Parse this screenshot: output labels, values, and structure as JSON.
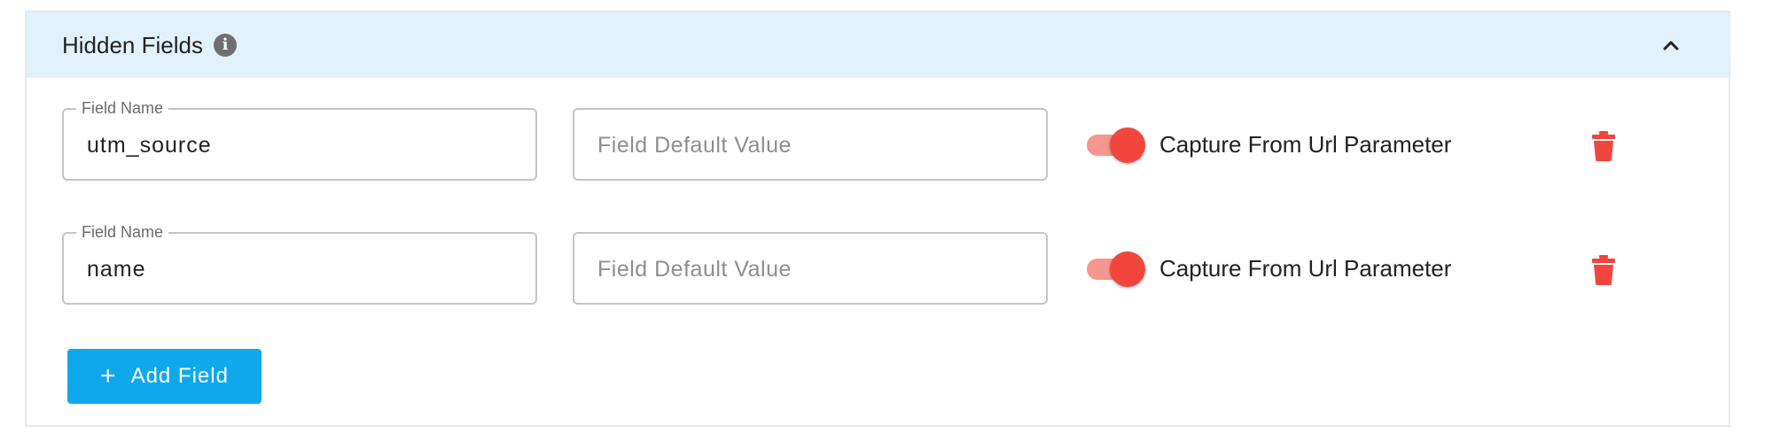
{
  "panel": {
    "title": "Hidden Fields",
    "info_icon": "info-icon",
    "collapse_icon": "chevron-up-icon"
  },
  "rows": [
    {
      "field_name_label": "Field Name",
      "field_name_value": "utm_source",
      "default_value_placeholder": "Field Default Value",
      "capture_enabled": true,
      "capture_label": "Capture From Url Parameter",
      "delete_icon": "trash-icon"
    },
    {
      "field_name_label": "Field Name",
      "field_name_value": "name",
      "default_value_placeholder": "Field Default Value",
      "capture_enabled": true,
      "capture_label": "Capture From Url Parameter",
      "delete_icon": "trash-icon"
    }
  ],
  "add_button": {
    "icon": "plus-icon",
    "label": "Add Field"
  },
  "colors": {
    "header_bg": "#e1f2fc",
    "toggle_on": "#f2453d",
    "delete": "#f2453d",
    "primary": "#10a8ec"
  }
}
